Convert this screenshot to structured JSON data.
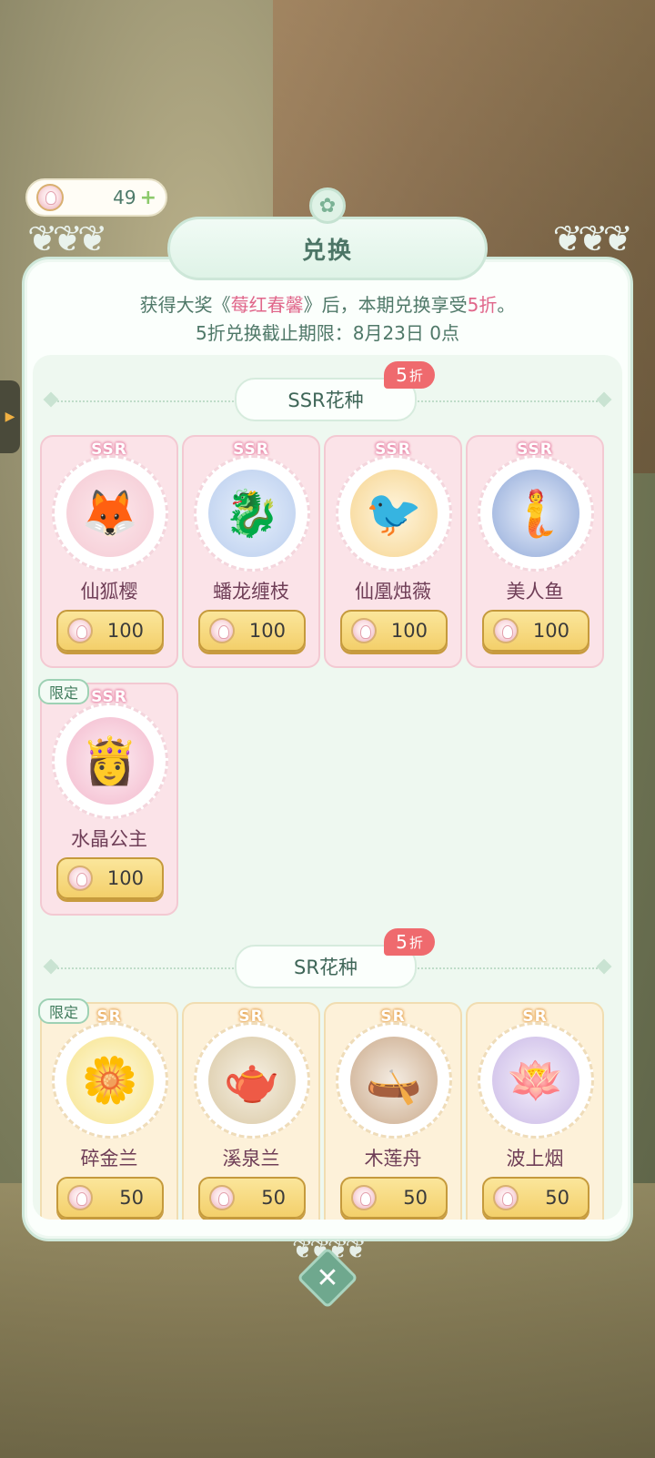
{
  "currency": {
    "amount": "49",
    "plus": "+"
  },
  "dialog": {
    "title": "兑换",
    "notice_pre": "获得大奖《",
    "notice_prize": "莓红春馨",
    "notice_mid": "》后，本期兑换享受",
    "notice_discount": "5折",
    "notice_end": "。",
    "deadline": "5折兑换截止期限：8月23日 0点",
    "close_label": "✕"
  },
  "sections": {
    "ssr": {
      "title": "SSR花种",
      "discount_num": "5",
      "discount_unit": "折"
    },
    "sr": {
      "title": "SR花种",
      "discount_num": "5",
      "discount_unit": "折"
    }
  },
  "ssr_items": [
    {
      "rarity": "SSR",
      "name": "仙狐樱",
      "price": "100",
      "icon": "fox-shrine-icon"
    },
    {
      "rarity": "SSR",
      "name": "蟠龙缠枝",
      "price": "100",
      "icon": "blue-dragon-icon"
    },
    {
      "rarity": "SSR",
      "name": "仙凰烛薇",
      "price": "100",
      "icon": "phoenix-icon"
    },
    {
      "rarity": "SSR",
      "name": "美人鱼",
      "price": "100",
      "icon": "mermaid-icon"
    },
    {
      "rarity": "SSR",
      "name": "水晶公主",
      "price": "100",
      "icon": "princess-icon",
      "badge": "限定"
    }
  ],
  "sr_items": [
    {
      "rarity": "SR",
      "name": "碎金兰",
      "price": "50",
      "icon": "yellow-flower-icon",
      "badge": "限定"
    },
    {
      "rarity": "SR",
      "name": "溪泉兰",
      "price": "50",
      "icon": "teapot-fountain-icon"
    },
    {
      "rarity": "SR",
      "name": "木莲舟",
      "price": "50",
      "icon": "lotus-boat-icon"
    },
    {
      "rarity": "SR",
      "name": "波上烟",
      "price": "50",
      "icon": "purple-lotus-icon"
    }
  ],
  "colors": {
    "accent_green": "#4c7566",
    "discount_red": "#ef6a6e",
    "highlight_pink": "#e0668a",
    "price_gold": "#f3cf6a"
  }
}
